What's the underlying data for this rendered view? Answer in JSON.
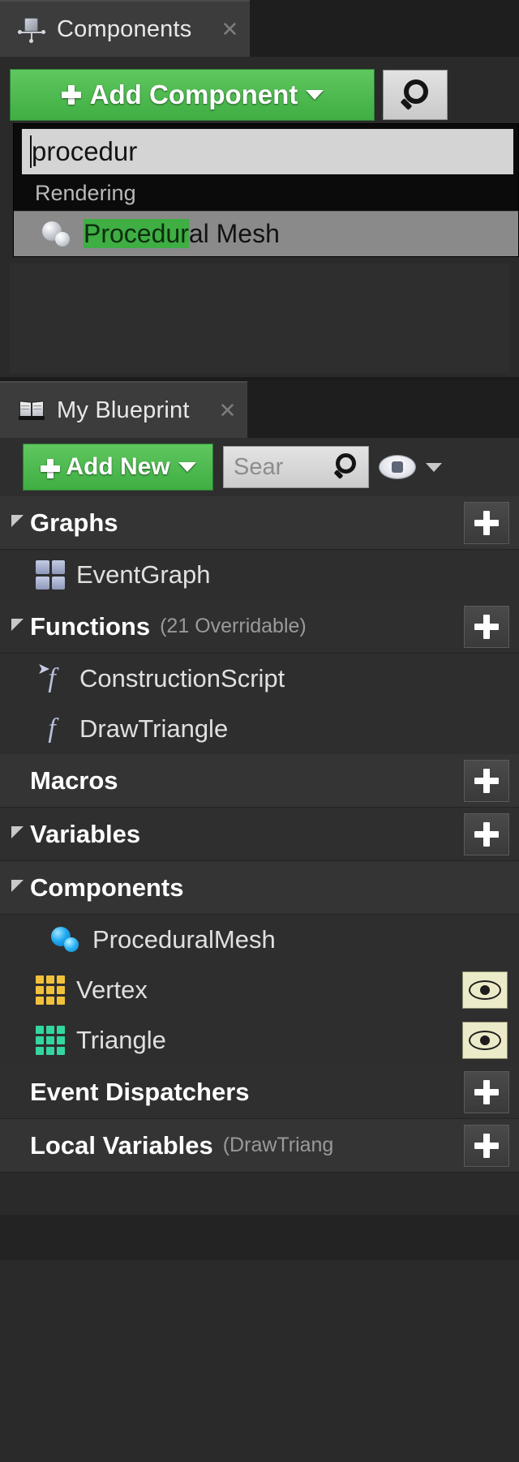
{
  "theme": {
    "accent_green": "#3fae43",
    "panel_bg": "#2a2a2a",
    "tab_bg": "#3c3c3c",
    "text": "#e8e8e8",
    "vertex_icon_color": "#f2c13c",
    "triangle_icon_color": "#33d6a0",
    "highlight_green": "#3fae43"
  },
  "components_panel": {
    "tab": {
      "title": "Components",
      "icon": "components-icon",
      "close_label": "✕"
    },
    "add_component_button": {
      "label": "Add Component",
      "caret": "▾"
    },
    "search_button": {
      "icon": "search-icon"
    },
    "filter_input": {
      "value": "procedur",
      "placeholder": ""
    },
    "dropdown": {
      "category": "Rendering",
      "results": [
        {
          "icon": "mesh-icon",
          "match": "Procedur",
          "rest": "al Mesh",
          "full_label": "Procedural Mesh"
        }
      ]
    }
  },
  "myblueprint_panel": {
    "tab": {
      "title": "My Blueprint",
      "icon": "book-icon",
      "close_label": "✕"
    },
    "toolbar": {
      "add_new_button": {
        "label": "Add New",
        "caret": "▾"
      },
      "search": {
        "value": "",
        "placeholder": "Sear",
        "icon": "search-icon"
      },
      "visibility_icon": "eye-icon",
      "visibility_caret": "▾"
    },
    "sections": [
      {
        "name": "graphs",
        "title": "Graphs",
        "note": "",
        "expanded": true,
        "has_add": true,
        "add_label": "+",
        "items": [
          {
            "name": "eventgraph",
            "label": "EventGraph",
            "icon": "grid2-icon",
            "indent": 1
          }
        ]
      },
      {
        "name": "functions",
        "title": "Functions",
        "note": "(21 Overridable)",
        "expanded": true,
        "has_add": true,
        "add_label": "+",
        "items": [
          {
            "name": "constructionscript",
            "label": "ConstructionScript",
            "icon": "function-arrow-icon",
            "indent": 1
          },
          {
            "name": "drawtriangle",
            "label": "DrawTriangle",
            "icon": "function-icon",
            "indent": 1
          }
        ]
      },
      {
        "name": "macros",
        "title": "Macros",
        "note": "",
        "expanded": false,
        "has_add": true,
        "add_label": "+",
        "items": []
      },
      {
        "name": "variables",
        "title": "Variables",
        "note": "",
        "expanded": true,
        "has_add": true,
        "add_label": "+",
        "items": []
      },
      {
        "name": "components",
        "title": "Components",
        "note": "",
        "expanded": true,
        "has_add": false,
        "add_label": "",
        "items": [
          {
            "name": "proceduralmesh",
            "label": "ProceduralMesh",
            "icon": "mesh-icon",
            "indent": 2
          },
          {
            "name": "vertex",
            "label": "Vertex",
            "icon": "grid3-icon",
            "indent": 1,
            "icon_color": "#f2c13c",
            "eye": true
          },
          {
            "name": "triangle",
            "label": "Triangle",
            "icon": "grid3-icon",
            "indent": 1,
            "icon_color": "#33d6a0",
            "eye": true
          }
        ]
      },
      {
        "name": "event-dispatchers",
        "title": "Event Dispatchers",
        "note": "",
        "expanded": false,
        "has_add": true,
        "add_label": "+",
        "items": []
      },
      {
        "name": "local-variables",
        "title": "Local Variables",
        "note": "(DrawTriang",
        "expanded": false,
        "has_add": true,
        "add_label": "+",
        "items": []
      }
    ]
  }
}
